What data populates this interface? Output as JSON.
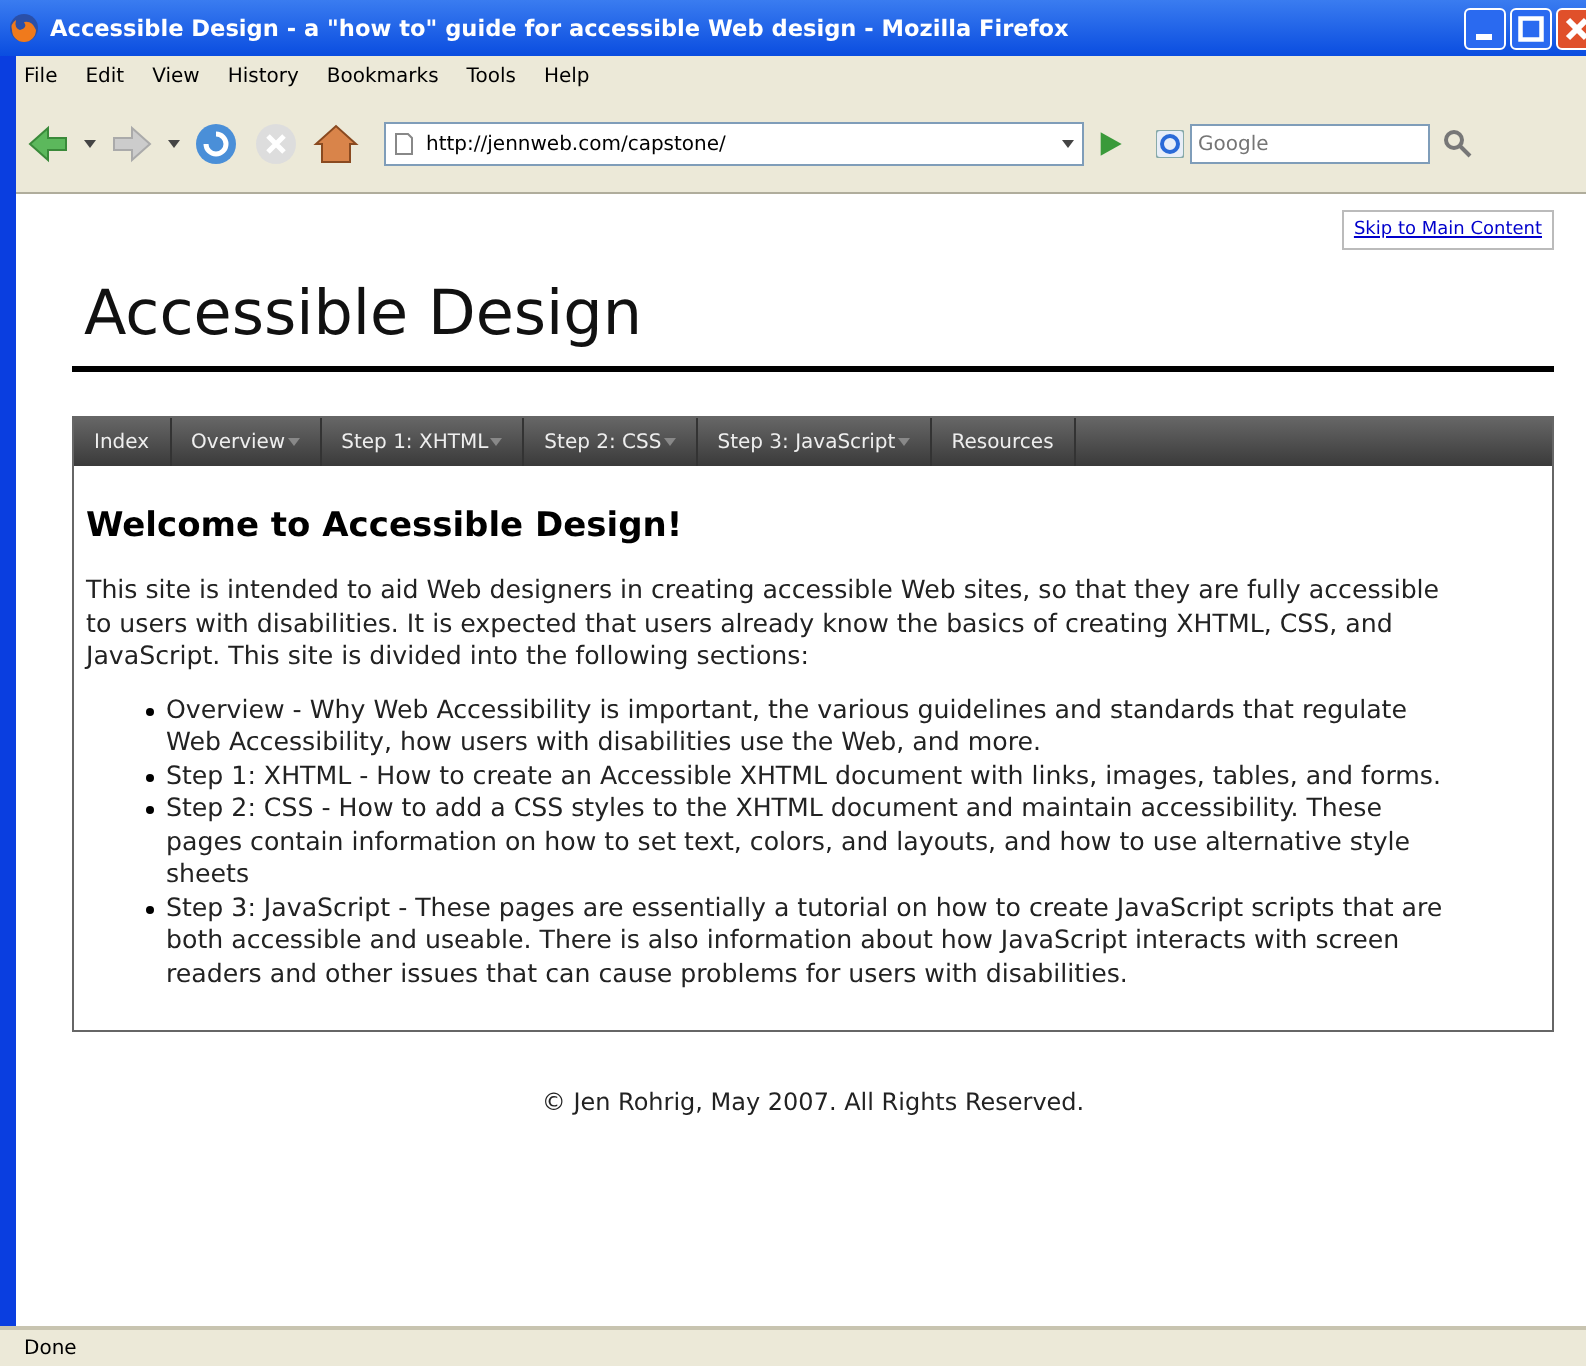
{
  "window": {
    "title": "Accessible Design - a \"how to\" guide for accessible Web design - Mozilla Firefox"
  },
  "menu": [
    "File",
    "Edit",
    "View",
    "History",
    "Bookmarks",
    "Tools",
    "Help"
  ],
  "toolbar": {
    "address": "http://jennweb.com/capstone/",
    "search": {
      "placeholder": "Google"
    }
  },
  "page": {
    "skip_link": "Skip to Main Content",
    "site_title": "Accessible Design",
    "nav": [
      {
        "label": "Index",
        "has_menu": false
      },
      {
        "label": "Overview",
        "has_menu": true
      },
      {
        "label": "Step 1: XHTML",
        "has_menu": true
      },
      {
        "label": "Step 2: CSS",
        "has_menu": true
      },
      {
        "label": "Step 3: JavaScript",
        "has_menu": true
      },
      {
        "label": "Resources",
        "has_menu": false
      }
    ],
    "heading": "Welcome to Accessible Design!",
    "intro": "This site is intended to aid Web designers in creating accessible Web sites, so that they are fully accessible to users with disabilities. It is expected that users already know the basics of creating XHTML, CSS, and JavaScript. This site is divided into the following sections:",
    "sections": [
      "Overview - Why Web Accessibility is important, the various guidelines and standards that regulate Web Accessibility, how users with disabilities use the Web, and more.",
      "Step 1: XHTML - How to create an Accessible XHTML document with links, images, tables, and forms.",
      "Step 2: CSS - How to add a CSS styles to the XHTML document and maintain accessibility. These pages contain information on how to set text, colors, and layouts, and how to use alternative style sheets",
      "Step 3: JavaScript - These pages are essentially a tutorial on how to create JavaScript scripts that are both accessible and useable. There is also information about how JavaScript interacts with screen readers and other issues that can cause problems for users with disabilities."
    ],
    "footer": "© Jen Rohrig, May 2007. All Rights Reserved."
  },
  "status_bar": "Done"
}
